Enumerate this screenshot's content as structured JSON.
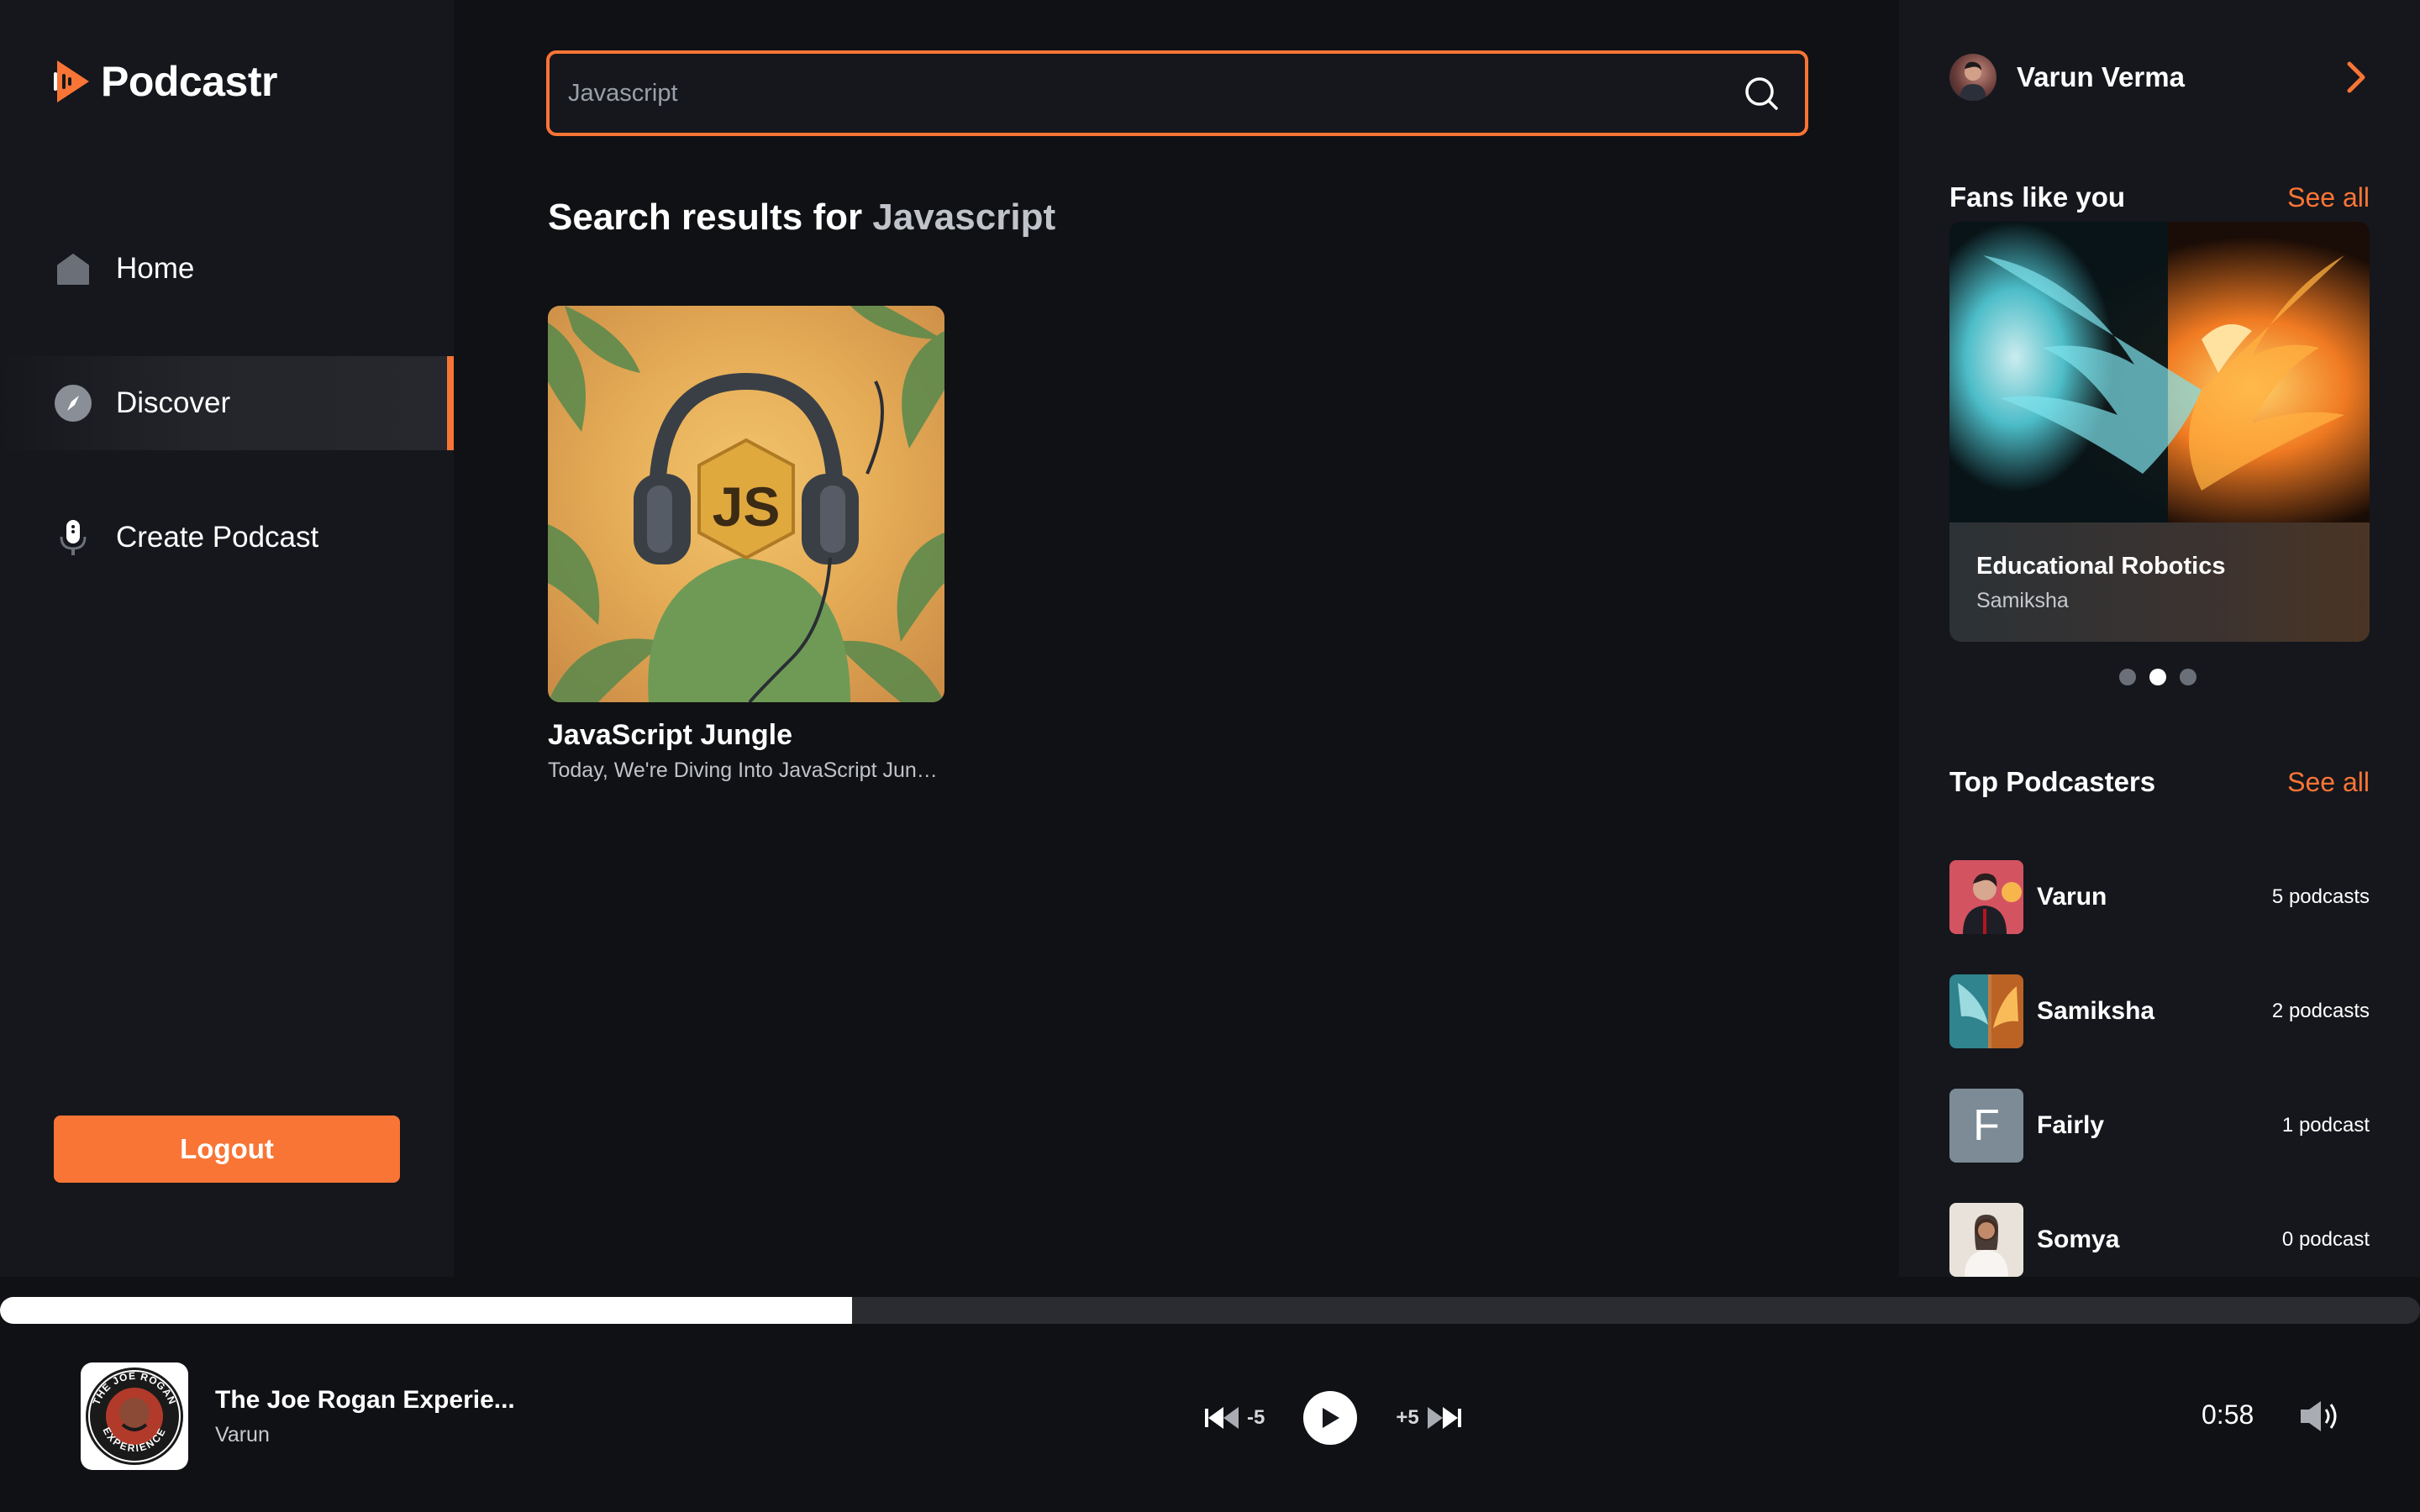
{
  "app": {
    "name": "Podcastr",
    "accent": "#f97535"
  },
  "sidebar": {
    "items": [
      {
        "label": "Home",
        "icon": "home-icon",
        "active": false
      },
      {
        "label": "Discover",
        "icon": "compass-icon",
        "active": true
      },
      {
        "label": "Create Podcast",
        "icon": "microphone-icon",
        "active": false
      }
    ],
    "logout_label": "Logout"
  },
  "search": {
    "value": "Javascript",
    "icon": "search-icon"
  },
  "results": {
    "prefix": "Search results for",
    "query": "Javascript",
    "cards": [
      {
        "title": "JavaScript Jungle",
        "description": "Today, We're Diving Into JavaScript Jungle..."
      }
    ]
  },
  "user": {
    "name": "Varun Verma"
  },
  "fans": {
    "title": "Fans like you",
    "see_all": "See all",
    "featured": {
      "title": "Educational Robotics",
      "author": "Samiksha"
    },
    "carousel_active_index": 1,
    "carousel_count": 3
  },
  "top_podcasters": {
    "title": "Top Podcasters",
    "see_all": "See all",
    "items": [
      {
        "name": "Varun",
        "count": "5 podcasts"
      },
      {
        "name": "Samiksha",
        "count": "2 podcasts"
      },
      {
        "name": "Fairly",
        "count": "1 podcast",
        "initial": "F"
      },
      {
        "name": "Somya",
        "count": "0 podcast"
      }
    ]
  },
  "player": {
    "title": "The Joe Rogan Experie...",
    "artist": "Varun",
    "cover_text_top": "THE JOE ROGAN",
    "cover_text_bottom": "EXPERIENCE",
    "rewind_label": "-5",
    "forward_label": "+5",
    "time": "0:58",
    "progress_fraction": 0.352
  }
}
